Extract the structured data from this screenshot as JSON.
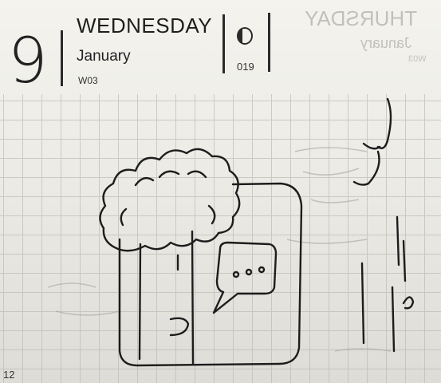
{
  "planner": {
    "day_number": "9",
    "weekday": "WEDNESDAY",
    "month": "January",
    "week": "W03",
    "day_of_year": "019",
    "page_number": "12",
    "bleed_weekday": "THURSDAY",
    "bleed_month": "January",
    "bleed_week": "W03"
  },
  "colors": {
    "ink": "#1d1d1d",
    "paper": "#f2f1ec",
    "grid": "#b9b8b3"
  }
}
